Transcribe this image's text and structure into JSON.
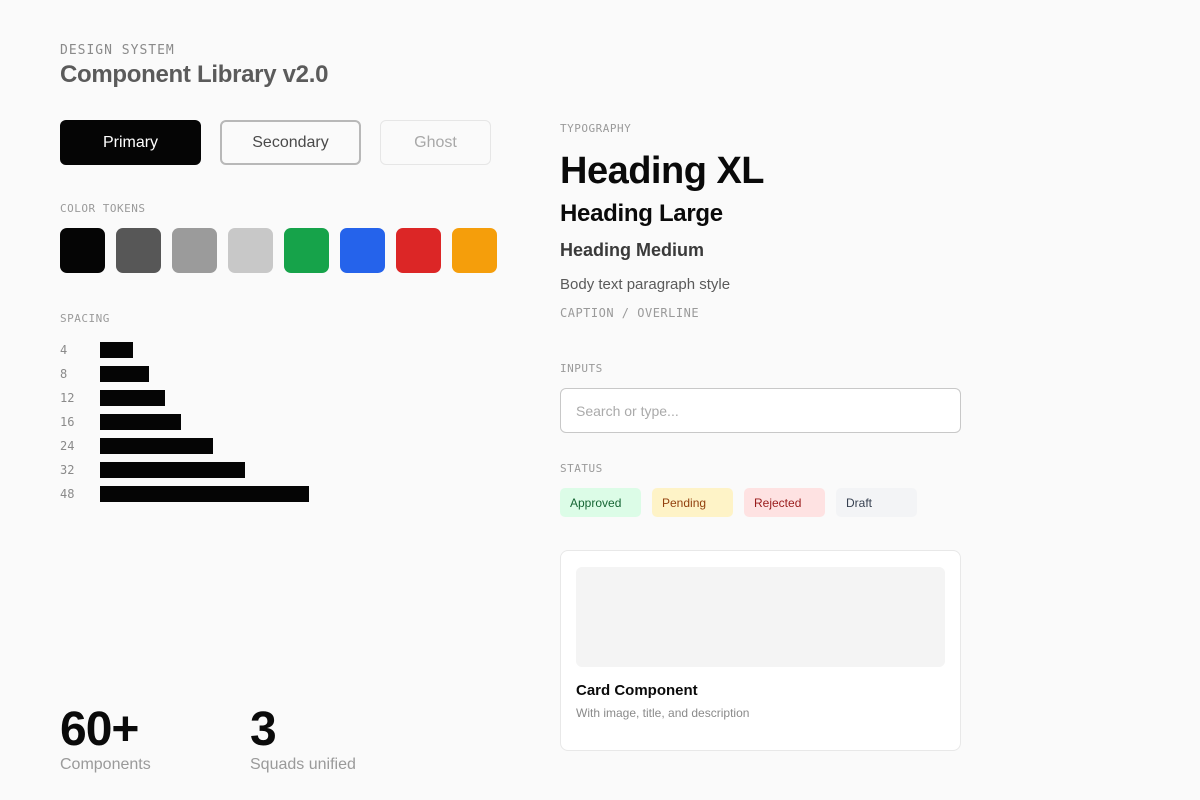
{
  "header": {
    "eyebrow": "DESIGN SYSTEM",
    "title": "Component Library v2.0"
  },
  "buttons": {
    "primary": "Primary",
    "secondary": "Secondary",
    "ghost": "Ghost"
  },
  "color_tokens": {
    "label": "COLOR TOKENS",
    "swatches": [
      "#050505",
      "#575757",
      "#9b9b9b",
      "#c8c8c8",
      "#16a34a",
      "#2563eb",
      "#dc2626",
      "#f59e0b"
    ]
  },
  "spacing": {
    "label": "SPACING",
    "scale": [
      4,
      8,
      12,
      16,
      24,
      32,
      48
    ]
  },
  "typography": {
    "label": "TYPOGRAPHY",
    "heading_xl": "Heading XL",
    "heading_large": "Heading Large",
    "heading_medium": "Heading Medium",
    "body": "Body text paragraph style",
    "caption": "CAPTION / OVERLINE"
  },
  "inputs": {
    "label": "INPUTS",
    "search_placeholder": "Search or type...",
    "search_value": ""
  },
  "status": {
    "label": "STATUS",
    "badges": [
      {
        "text": "Approved",
        "bg": "#dcfce7",
        "fg": "#166534"
      },
      {
        "text": "Pending",
        "bg": "#fef3c7",
        "fg": "#92400e"
      },
      {
        "text": "Rejected",
        "bg": "#fee2e2",
        "fg": "#991b1b"
      },
      {
        "text": "Draft",
        "bg": "#f3f4f6",
        "fg": "#374151"
      }
    ]
  },
  "card": {
    "title": "Card Component",
    "description": "With image, title, and description"
  },
  "stats": [
    {
      "value": "60+",
      "label": "Components"
    },
    {
      "value": "3",
      "label": "Squads unified"
    }
  ]
}
